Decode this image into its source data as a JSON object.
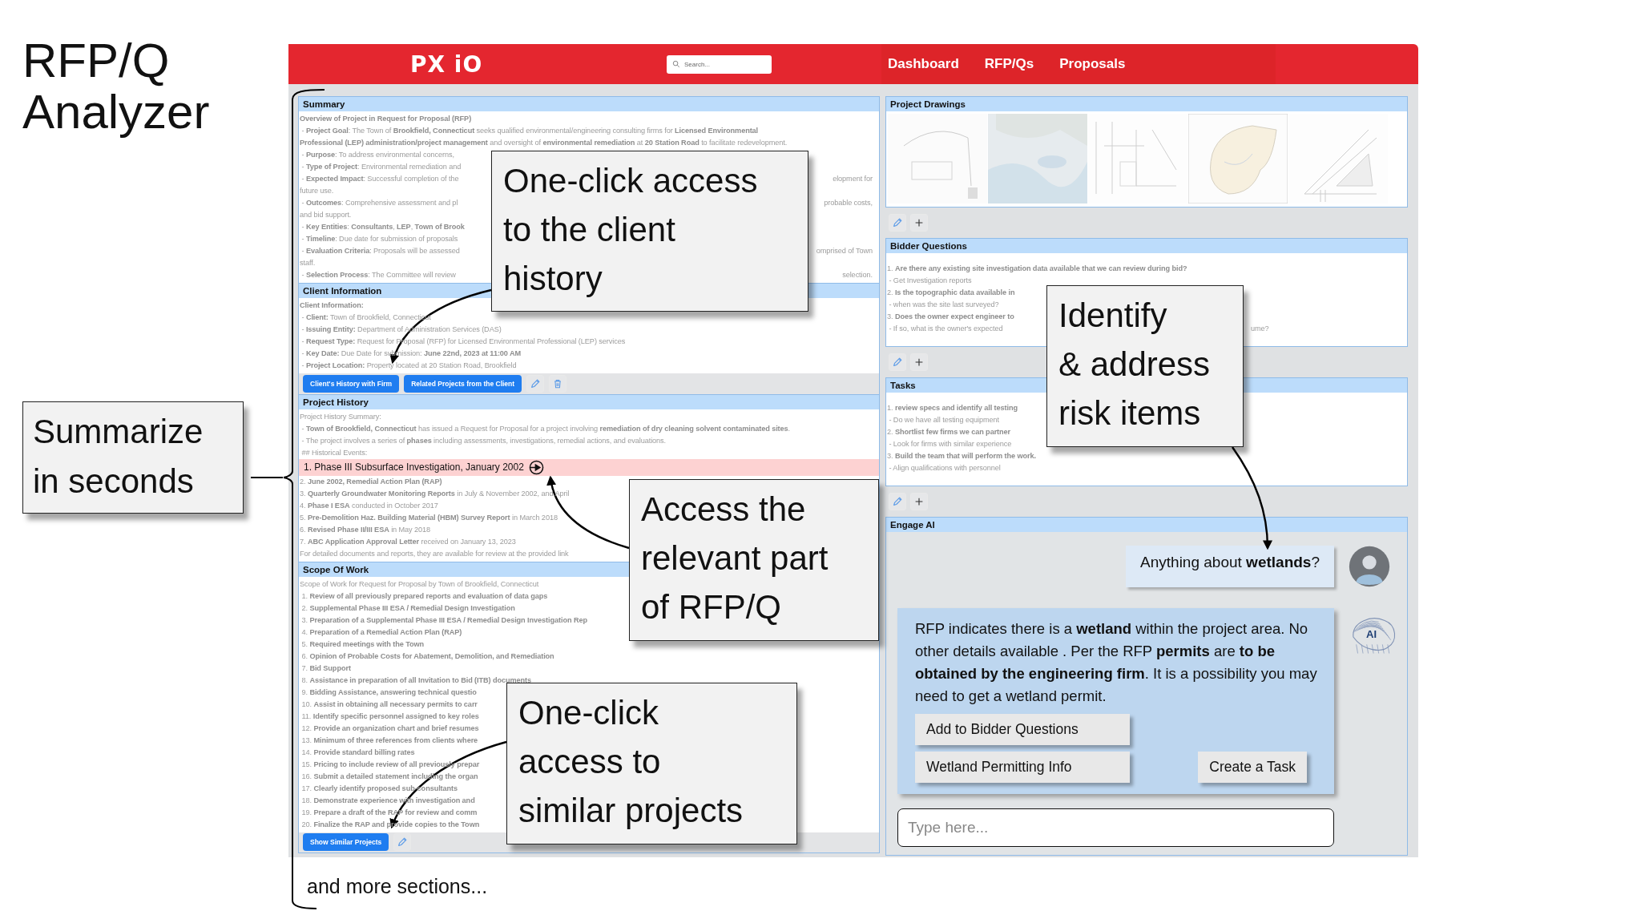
{
  "slide": {
    "title_lines": [
      "RFP/Q",
      "Analyzer"
    ],
    "footer": "and more sections..."
  },
  "callouts": [
    {
      "kind": "summary",
      "lines": [
        "Summarize",
        "in seconds"
      ]
    },
    {
      "kind": "client",
      "lines": [
        "One-click access",
        "to the client",
        "history"
      ]
    },
    {
      "kind": "history",
      "lines": [
        "Access the",
        "relevant  part",
        "of RFP/Q"
      ]
    },
    {
      "kind": "similar",
      "lines": [
        "One-click",
        "access to",
        "similar projects"
      ]
    },
    {
      "kind": "risk",
      "lines": [
        "Identify",
        "& address",
        "risk items"
      ]
    }
  ],
  "app": {
    "logo": "PX iO",
    "search": {
      "placeholder": "Search..."
    },
    "nav": [
      {
        "label": "Dashboard"
      },
      {
        "label": "RFP/Qs"
      },
      {
        "label": "Proposals"
      }
    ]
  },
  "left_sections": [
    {
      "title": "Summary",
      "lines": [
        {
          "text": "**Overview of Project in Request for Proposal (RFP)**"
        },
        {
          "text": " - **Project Goal**: The Town of **Brookfield, Connecticut** seeks qualified environmental/engineering consulting firms for **Licensed Environmental**"
        },
        {
          "text": "**Professional (LEP) administration/project management** and oversight of **environmental remediation** at **20 Station Road** to facilitate redevelopment."
        },
        {
          "text": " - **Purpose**: To address environmental concerns,"
        },
        {
          "text": " - **Type of Project**: Environmental remediation and"
        },
        {
          "text": " - **Expected Impact**: Successful completion of the",
          "tail": "elopment for"
        },
        {
          "text": "future use."
        },
        {
          "text": " - **Outcomes**: Comprehensive assessment and pl",
          "tail": "probable costs,"
        },
        {
          "text": "and bid support."
        },
        {
          "text": " - **Key Entities**: **Consultants**, **LEP**, **Town of Brook**"
        },
        {
          "text": " - **Timeline**: Due date for submission of proposals"
        },
        {
          "text": " - **Evaluation Criteria**: Proposals will be assessed",
          "tail": "omprised of Town"
        },
        {
          "text": "staff."
        },
        {
          "text": " - **Selection Process**: The Committee will review",
          "tail": "selection."
        }
      ]
    },
    {
      "title": "Client Information",
      "lines": [
        {
          "text": "**Client Information:**"
        },
        {
          "text": " - **Client:** Town of Brookfield, Connecticut"
        },
        {
          "text": " - **Issuing Entity:** Department of Administration Services (DAS)"
        },
        {
          "text": " - **Request Type:** Request for Proposal (RFP) for Licensed Environmental Professional (LEP) services"
        },
        {
          "text": " - **Key Date:** Due Date for submission: **June 22nd, 2023 at 11:00 AM**"
        },
        {
          "text": " - **Project Location:** Property located at 20 Station Road, Brookfield"
        }
      ],
      "toolbar": {
        "buttons": [
          "Client's History with Firm",
          "Related Projects from the Client"
        ],
        "icons": [
          {
            "kind": "edit"
          },
          {
            "kind": "delete"
          }
        ]
      }
    },
    {
      "title": "Project History",
      "lines": [
        {
          "text": "Project History Summary:",
          "highlighted": false
        },
        {
          "text": " - **Town of Brookfield, Connecticut** has issued a Request for Proposal for a project involving **remediation of dry cleaning solvent contaminated sites**.",
          "highlighted": false
        },
        {
          "text": " - The project involves a series of **phases** including assessments, investigations, remedial actions, and evaluations.",
          "highlighted": false
        },
        {
          "text": " ## Historical Events:",
          "highlighted": false
        },
        {
          "text": "1. Phase III Subsurface Investigation, January 2002",
          "highlighted": true
        },
        {
          "text": "2. **June 2002, Remedial Action Plan (RAP)**",
          "highlighted": false
        },
        {
          "text": "3. **Quarterly Groundwater Monitoring Reports** in July & November 2002, and April",
          "highlighted": false
        },
        {
          "text": "4. **Phase I ESA** conducted in October 2017",
          "highlighted": false
        },
        {
          "text": "5. **Pre-Demolition Haz. Building Material (HBM) Survey Report** in March 2018",
          "highlighted": false
        },
        {
          "text": "6. **Revised Phase II/III ESA** in May 2018",
          "highlighted": false
        },
        {
          "text": "7. **ABC Application Approval Letter** received on January 13, 2023",
          "highlighted": false
        },
        {
          "text": "For detailed documents and reports, they are available for review at the provided link",
          "highlighted": false
        }
      ]
    },
    {
      "title": "Scope Of Work",
      "lines": [
        {
          "text": "Scope of Work for Request for Proposal by Town of Brookfield, Connecticut"
        },
        {
          "text": " 1. **Review of all previously prepared reports and evaluation of data gaps**"
        },
        {
          "text": " 2. **Supplemental Phase III ESA / Remedial Design Investigation**"
        },
        {
          "text": " 3. **Preparation of a Supplemental Phase III ESA / Remedial Design Investigation Rep**"
        },
        {
          "text": " 4. **Preparation of a Remedial Action Plan (RAP)**"
        },
        {
          "text": " 5. **Required meetings with the Town**"
        },
        {
          "text": " 6. **Opinion of Probable Costs for Abatement, Demolition, and Remediation**"
        },
        {
          "text": " 7. **Bid Support**"
        },
        {
          "text": " 8. **Assistance in preparation of all Invitation to Bid (ITB) documents**"
        },
        {
          "text": " 9. **Bidding Assistance, answering technical questio**"
        },
        {
          "text": " 10. **Assist in obtaining all necessary permits to carr**"
        },
        {
          "text": " 11. **Identify specific personnel assigned to key roles**"
        },
        {
          "text": " 12. **Provide an organization chart and brief resumes**"
        },
        {
          "text": " 13. **Minimum of three references from clients where**"
        },
        {
          "text": " 14. **Provide standard billing rates**"
        },
        {
          "text": " 15. **Pricing to include review of all previously prepar**"
        },
        {
          "text": " 16. **Submit a detailed statement including the organ**"
        },
        {
          "text": " 17. **Clearly identify proposed sub-consultants**"
        },
        {
          "text": " 18. **Demonstrate experience with investigation and**"
        },
        {
          "text": " 19. **Prepare a draft of the RAP for review and comm**"
        },
        {
          "text": " 20. **Finalize the RAP and provide copies to the Town**"
        }
      ],
      "toolbar": {
        "buttons": [
          "Show Similar Projects"
        ],
        "icons": [
          {
            "kind": "edit"
          }
        ]
      }
    }
  ],
  "right_sections": [
    {
      "title": "Project Drawings",
      "toolbar": {
        "icons": [
          {
            "kind": "edit"
          },
          {
            "kind": "add"
          }
        ]
      }
    },
    {
      "title": "Bidder Questions",
      "lines": [
        {
          "text": "1. **Are there any existing site investigation data available that we can review during bid?**"
        },
        {
          "text": " - Get Investigation reports"
        },
        {
          "text": "2. **Is the topographic data available in**"
        },
        {
          "text": " - when was the site last surveyed?"
        },
        {
          "text": "3. **Does the owner expect engineer to**"
        },
        {
          "text": " - If so, what is the owner's expected",
          "tail": "ume?"
        }
      ],
      "toolbar": {
        "icons": [
          {
            "kind": "edit"
          },
          {
            "kind": "add"
          }
        ]
      }
    },
    {
      "title": "Tasks",
      "lines": [
        {
          "text": "1. **review specs and identify all testing**"
        },
        {
          "text": " - Do we have all testing equipment"
        },
        {
          "text": "2. **Shortlist few firms we can partner**"
        },
        {
          "text": " - Look for firms with similar experience"
        },
        {
          "text": "3. **Build the team that will perform the work.**"
        },
        {
          "text": " - Align qualifications with personnel"
        }
      ],
      "toolbar": {
        "icons": [
          {
            "kind": "edit"
          },
          {
            "kind": "add"
          }
        ]
      }
    }
  ],
  "chat": {
    "title": "Engage AI",
    "messages": [
      {
        "kind": "user",
        "text": "Anything about **wetlands**?"
      },
      {
        "kind": "ai",
        "badge": "AI",
        "text": "RFP indicates there is a **wetland** within the project area. No other details available . Per the RFP  **permits** are **to be obtained by the engineering firm**. It is a possibility you may need to get a wetland permit.",
        "actions": [
          "Add to Bidder Questions",
          "Wetland Permitting Info",
          "Create a Task"
        ]
      }
    ],
    "input": {
      "placeholder": "Type here..."
    }
  }
}
